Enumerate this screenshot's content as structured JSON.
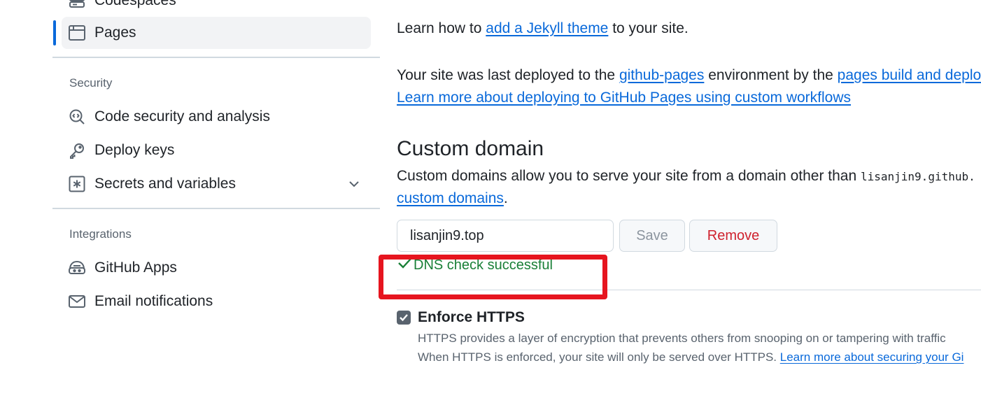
{
  "sidebar": {
    "items_top": [
      {
        "label": "Codespaces",
        "icon": "codespaces-icon"
      },
      {
        "label": "Pages",
        "icon": "browser-icon",
        "active": true
      }
    ],
    "security": {
      "title": "Security",
      "items": [
        {
          "label": "Code security and analysis",
          "icon": "codescan-icon"
        },
        {
          "label": "Deploy keys",
          "icon": "key-icon"
        },
        {
          "label": "Secrets and variables",
          "icon": "asterisk-icon"
        }
      ]
    },
    "integrations": {
      "title": "Integrations",
      "items": [
        {
          "label": "GitHub Apps",
          "icon": "apps-icon"
        },
        {
          "label": "Email notifications",
          "icon": "mail-icon"
        }
      ]
    }
  },
  "main": {
    "jekyll": {
      "prefix": "Learn how to ",
      "link": "add a Jekyll theme",
      "suffix": " to your site."
    },
    "deploy": {
      "prefix": "Your site was last deployed to the ",
      "env_link": "github-pages",
      "middle": " environment by the ",
      "workflow_link": "pages build and deplo",
      "learn_link": "Learn more about deploying to GitHub Pages using custom workflows"
    },
    "custom_domain": {
      "title": "Custom domain",
      "desc_prefix": "Custom domains allow you to serve your site from a domain other than ",
      "desc_code": "lisanjin9.github.",
      "desc_link": "custom domains",
      "desc_suffix": ".",
      "input_value": "lisanjin9.top",
      "save_label": "Save",
      "remove_label": "Remove",
      "dns_status": "DNS check successful"
    },
    "https": {
      "label": "Enforce HTTPS",
      "checked": true,
      "line1": "HTTPS provides a layer of encryption that prevents others from snooping on or tampering with traffic",
      "line2_prefix": "When HTTPS is enforced, your site will only be served over HTTPS. ",
      "line2_link": "Learn more about securing your Gi"
    }
  },
  "colors": {
    "accent": "#0969da",
    "success": "#1a7f37",
    "danger": "#cf222e",
    "highlight": "#e6151f"
  }
}
